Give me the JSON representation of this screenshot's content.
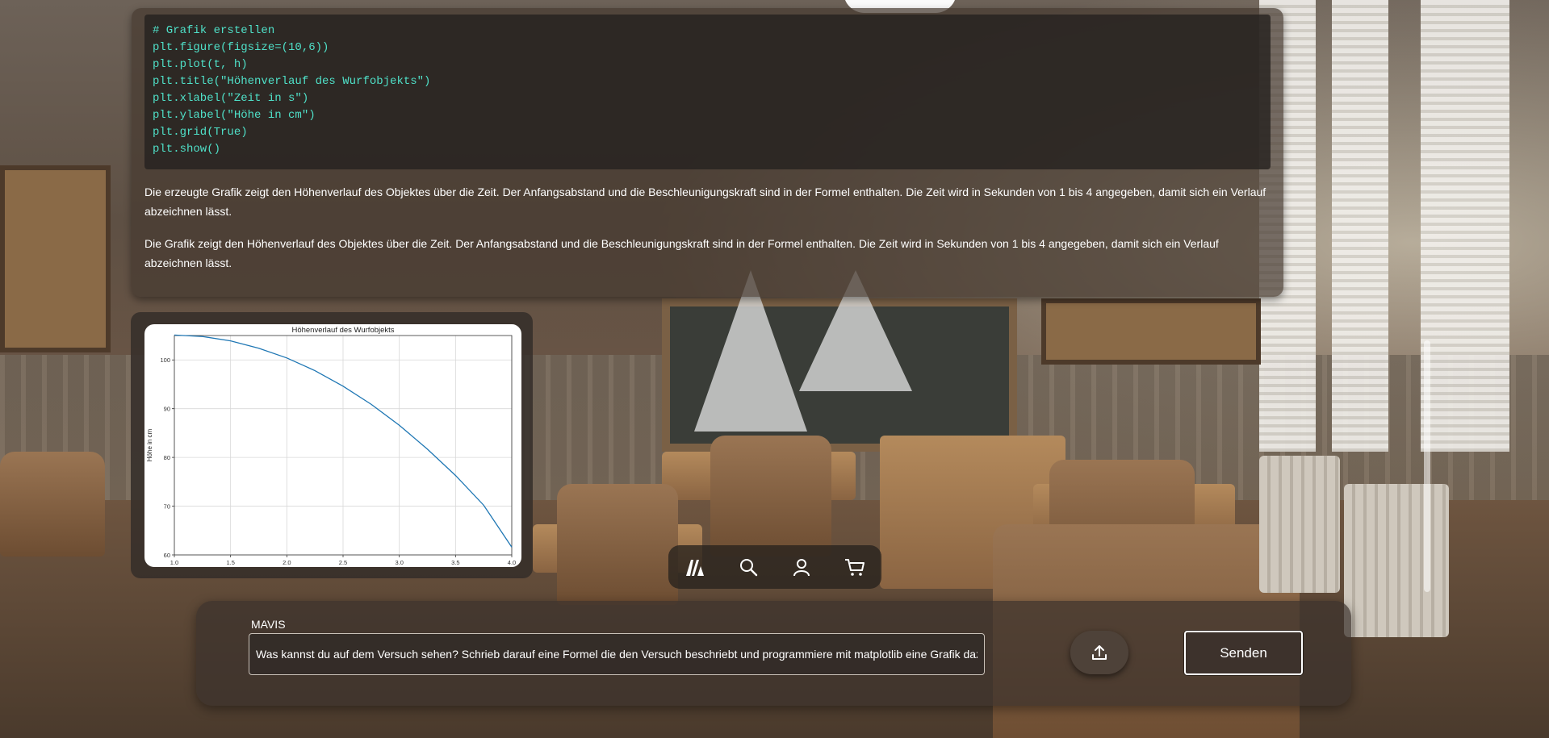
{
  "code_lines": [
    "# Grafik erstellen",
    "plt.figure(figsize=(10,6))",
    "plt.plot(t, h)",
    "plt.title(\"Höhenverlauf des Wurfobjekts\")",
    "plt.xlabel(\"Zeit in s\")",
    "plt.ylabel(\"Höhe in cm\")",
    "plt.grid(True)",
    "plt.show()"
  ],
  "paragraphs": [
    "Die erzeugte Grafik zeigt den Höhenverlauf des Objektes über die Zeit. Der Anfangsabstand und die Beschleunigungskraft sind in der Formel enthalten. Die Zeit wird in Sekunden von 1 bis 4 angegeben, damit sich ein Verlauf abzeichnen lässt.",
    "Die Grafik zeigt den Höhenverlauf des Objektes über die Zeit. Der Anfangsabstand und die Beschleunigungskraft sind in der Formel enthalten. Die Zeit wird in Sekunden von 1 bis 4 angegeben, damit sich ein Verlauf abzeichnen lässt."
  ],
  "chart_data": {
    "type": "line",
    "title": "Höhenverlauf des Wurfobjekts",
    "xlabel": "Zeit in s",
    "ylabel": "Höhe in cm",
    "xlim": [
      1.0,
      4.0
    ],
    "ylim": [
      60,
      105
    ],
    "xticks": [
      "1.0",
      "1.5",
      "2.0",
      "2.5",
      "3.0",
      "3.5",
      "4.0"
    ],
    "yticks": [
      "60",
      "70",
      "80",
      "90",
      "100"
    ],
    "grid": true,
    "series": [
      {
        "color": "#1f77b4",
        "x": [
          1.0,
          1.25,
          1.5,
          1.75,
          2.0,
          2.25,
          2.5,
          2.75,
          3.0,
          3.25,
          3.5,
          3.75,
          4.0
        ],
        "y": [
          105.1,
          104.8,
          103.9,
          102.4,
          100.4,
          97.8,
          94.6,
          90.9,
          86.6,
          81.7,
          76.3,
          70.2,
          61.6
        ]
      }
    ]
  },
  "nav": {
    "items": [
      {
        "name": "logo-icon"
      },
      {
        "name": "search-icon"
      },
      {
        "name": "user-icon"
      },
      {
        "name": "cart-icon"
      }
    ]
  },
  "input": {
    "label": "MAVIS",
    "value": "Was kannst du auf dem Versuch sehen? Schrieb darauf eine Formel die den Versuch beschriebt und programmiere mit matplotlib eine Grafik dazu in Pyth",
    "upload_icon": "upload-icon",
    "send_label": "Senden"
  },
  "colors": {
    "code_text": "#4fe0c8",
    "line": "#1f77b4"
  }
}
